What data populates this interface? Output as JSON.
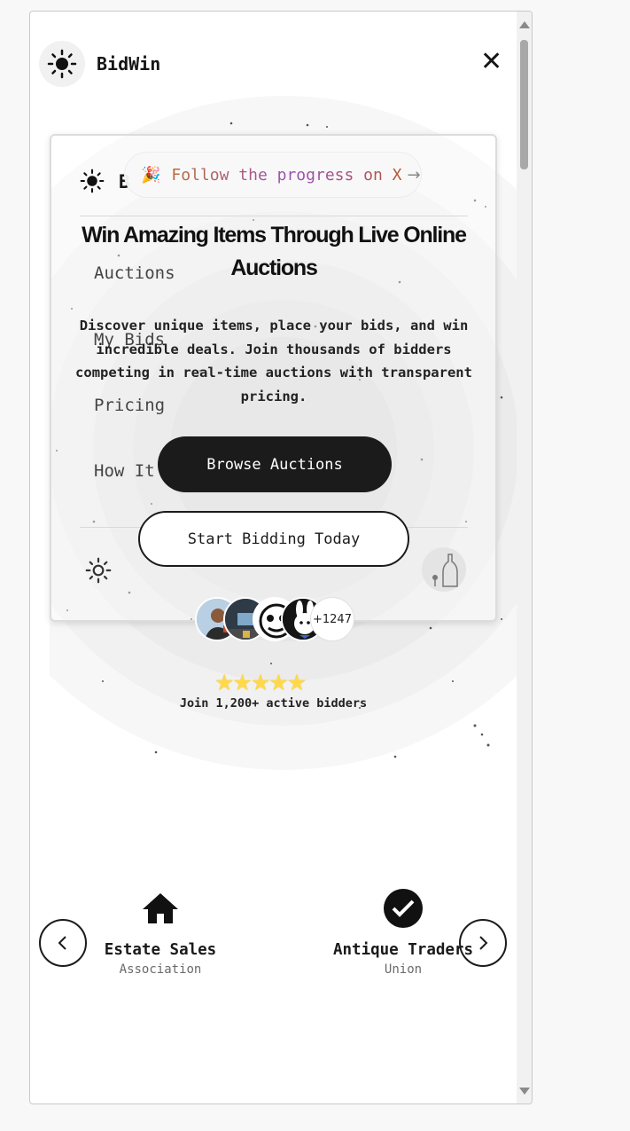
{
  "header": {
    "brand": "BidWin",
    "close_icon": "close-icon"
  },
  "preview_card": {
    "brand_initial": "B",
    "nav_items": [
      "Auctions",
      "My Bids",
      "Pricing",
      "How It"
    ]
  },
  "announcement": {
    "text": "Follow the progress on X",
    "arrow": "→"
  },
  "hero": {
    "title": "Win Amazing Items Through Live Online Auctions",
    "description": "Discover unique items, place your bids, and win incredible deals. Join thousands of bidders competing in real-time auctions with transparent pricing.",
    "primary_button": "Browse Auctions",
    "secondary_button": "Start Bidding Today"
  },
  "social_proof": {
    "extra_count": "+1247",
    "rating": 5,
    "caption": "Join 1,200+ active bidders"
  },
  "partners": [
    {
      "name": "Estate Sales",
      "subtitle": "Association",
      "icon": "home-icon"
    },
    {
      "name": "Antique Traders",
      "subtitle": "Union",
      "icon": "check-circle-icon"
    }
  ],
  "colors": {
    "primary": "#1b1b1b",
    "star": "#ffd94a",
    "background": "#ffffff"
  }
}
